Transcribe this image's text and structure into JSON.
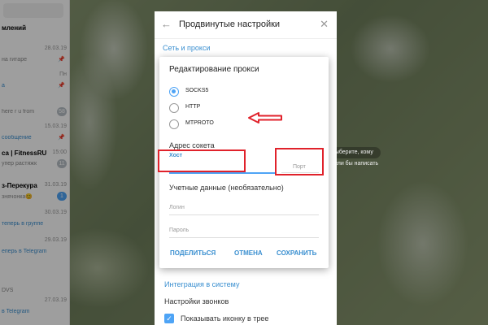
{
  "chat_list": {
    "items": [
      {
        "name": "млений",
        "date": "",
        "message": "",
        "badge": ""
      },
      {
        "name": "",
        "date": "28.03.19",
        "message": "на гитаре",
        "badge": ""
      },
      {
        "name": "",
        "date": "Пн",
        "message": "а",
        "badge": ""
      },
      {
        "name": "",
        "date": "",
        "message": "here r u from",
        "badge": "58"
      },
      {
        "name": "",
        "date": "15.03.19",
        "message": "сообщение",
        "badge": ""
      },
      {
        "name": "са | FitnessRU",
        "date": "15:00",
        "message": "упер растяжк",
        "badge": "11"
      },
      {
        "name": "з-Перекура",
        "date": "31.03.19",
        "message": "знячонка😊",
        "badge": "1"
      },
      {
        "name": "",
        "date": "30.03.19",
        "message": "теперь в группе",
        "badge": ""
      },
      {
        "name": "",
        "date": "29.03.19",
        "message": "еперь в Telegram",
        "badge": ""
      },
      {
        "name": "",
        "date": "",
        "message": "DVS",
        "badge": ""
      },
      {
        "name": "",
        "date": "27.03.19",
        "message": "в Telegram",
        "badge": ""
      }
    ]
  },
  "chat_hint": "Выберите, кому хотели бы написать",
  "settings": {
    "title": "Продвинутые настройки",
    "section_link": "Сеть и прокси",
    "integration": "Интеграция в систему",
    "calls": "Настройки звонков",
    "tray_label": "Показывать иконку в трее"
  },
  "dialog": {
    "title": "Редактирование прокси",
    "options": [
      {
        "label": "SOCKS5",
        "selected": true
      },
      {
        "label": "HTTP",
        "selected": false
      },
      {
        "label": "MTPROTO",
        "selected": false
      }
    ],
    "socket_label": "Адрес сокета",
    "host_label": "Хост",
    "port_label": "Порт",
    "creds_label": "Учетные данные (необязательно)",
    "login_placeholder": "Логин",
    "password_placeholder": "Пароль",
    "share_button": "ПОДЕЛИТЬСЯ",
    "cancel_button": "ОТМЕНА",
    "save_button": "СОХРАНИТЬ"
  },
  "colors": {
    "accent": "#4ea4f6",
    "link": "#3a8fd0",
    "annotation": "#e0222b"
  }
}
